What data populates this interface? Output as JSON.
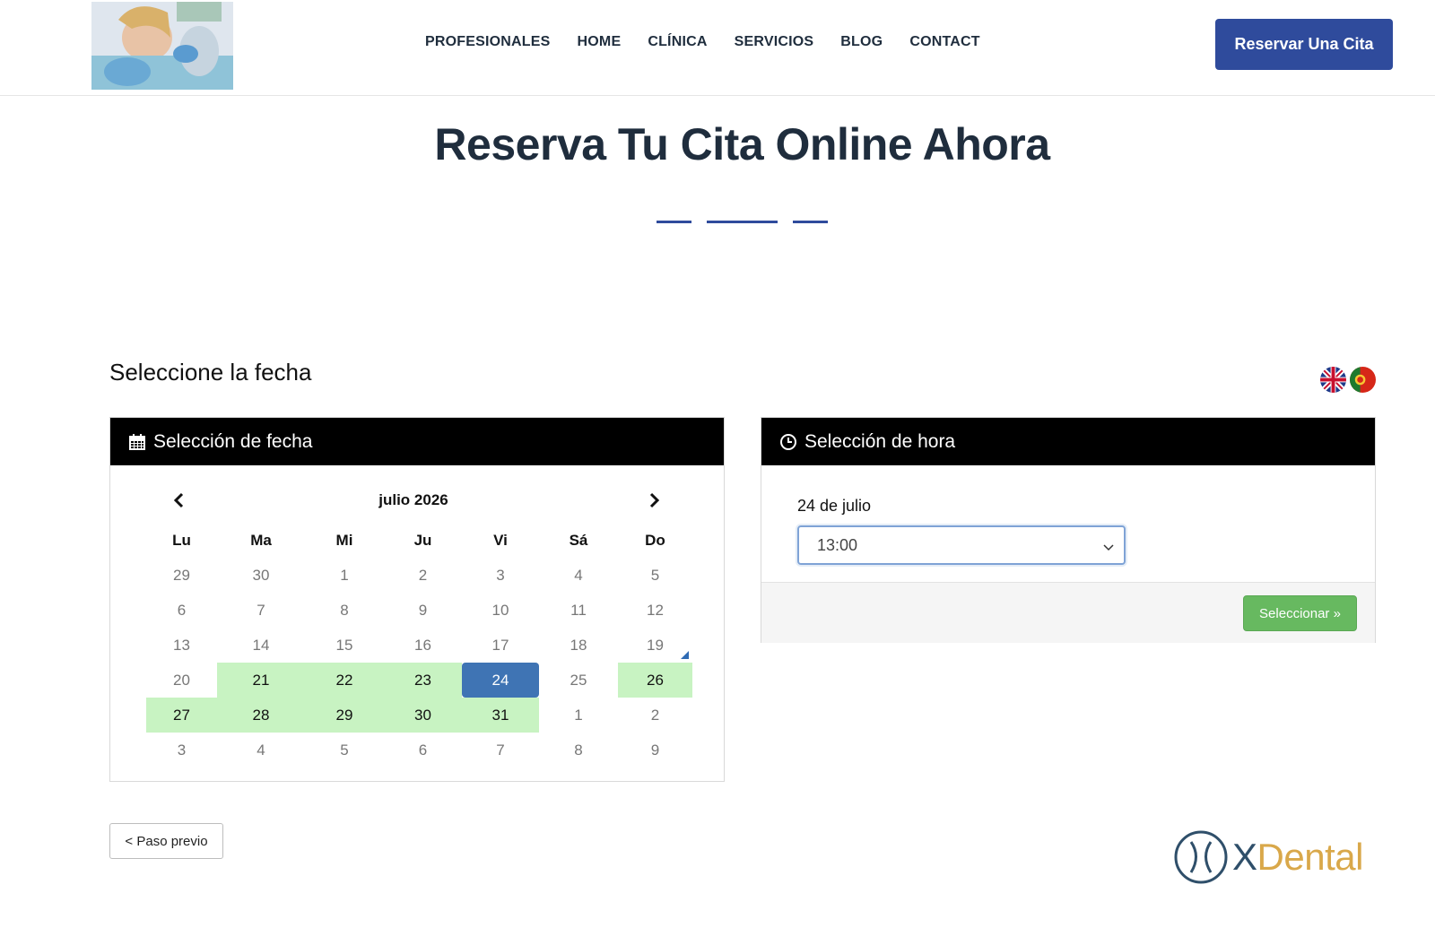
{
  "header": {
    "nav": [
      "PROFESIONALES",
      "HOME",
      "CLÍNICA",
      "SERVICIOS",
      "BLOG",
      "CONTACT"
    ],
    "cta_label": "Reservar Una Cita"
  },
  "page_title": "Reserva Tu Cita Online Ahora",
  "section_label": "Seleccione la fecha",
  "flags": [
    "uk-flag-icon",
    "portugal-flag-icon"
  ],
  "calendar": {
    "header_label": "Selección de fecha",
    "month_label": "julio 2026",
    "weekdays": [
      "Lu",
      "Ma",
      "Mi",
      "Ju",
      "Vi",
      "Sá",
      "Do"
    ],
    "weeks": [
      [
        "29",
        "30",
        "1",
        "2",
        "3",
        "4",
        "5"
      ],
      [
        "6",
        "7",
        "8",
        "9",
        "10",
        "11",
        "12"
      ],
      [
        "13",
        "14",
        "15",
        "16",
        "17",
        "18",
        "19"
      ],
      [
        "20",
        "21",
        "22",
        "23",
        "24",
        "25",
        "26"
      ],
      [
        "27",
        "28",
        "29",
        "30",
        "31",
        "1",
        "2"
      ],
      [
        "3",
        "4",
        "5",
        "6",
        "7",
        "8",
        "9"
      ]
    ],
    "available_days": [
      "21",
      "22",
      "23",
      "26",
      "27",
      "28",
      "29",
      "30",
      "31"
    ],
    "selected_day": "24",
    "today_day": "19"
  },
  "time": {
    "header_label": "Selección de hora",
    "date_label": "24 de julio",
    "selected_time": "13:00",
    "select_button": "Seleccionar »"
  },
  "prev_button": "< Paso previo",
  "brand": {
    "prefix": "X",
    "name": "Dental"
  },
  "colors": {
    "primary": "#2f4b9c",
    "available": "#c8f3c2",
    "selected": "#3f74b4",
    "success": "#67b960"
  }
}
